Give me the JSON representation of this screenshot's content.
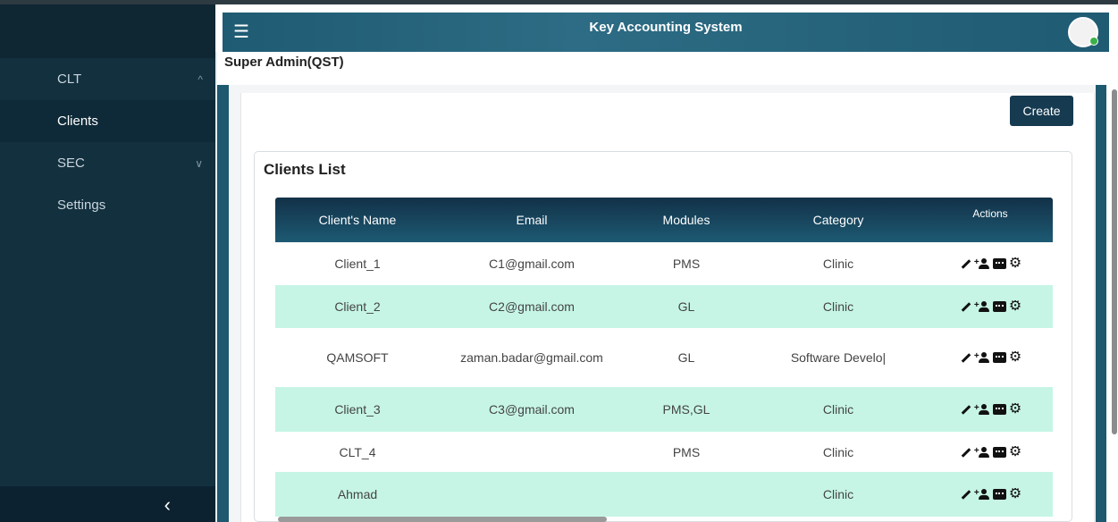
{
  "app": {
    "title": "Key Accounting System",
    "user_label": "Super Admin(QST)",
    "menu_icon": "menu-icon",
    "avatar_icon": "avatar"
  },
  "sidebar": {
    "items": [
      {
        "label": "CLT",
        "chevron": "^"
      },
      {
        "label": "Clients"
      },
      {
        "label": "SEC",
        "chevron": "∨"
      },
      {
        "label": "Settings"
      }
    ],
    "collapse_label": "‹"
  },
  "toolbar": {
    "create_label": "Create"
  },
  "clients": {
    "title": "Clients List",
    "headers": [
      "Client's Name",
      "Email",
      "Modules",
      "Category",
      "Actions"
    ],
    "rows": [
      {
        "name": "Client_1",
        "email": "C1@gmail.com",
        "modules": "PMS",
        "category": "Clinic"
      },
      {
        "name": "Client_2",
        "email": "C2@gmail.com",
        "modules": "GL",
        "category": "Clinic"
      },
      {
        "name": "QAMSOFT",
        "email": "zaman.badar@gmail.com",
        "modules": "GL",
        "category": "Software Develo|"
      },
      {
        "name": "Client_3",
        "email": "C3@gmail.com",
        "modules": "PMS,GL",
        "category": "Clinic"
      },
      {
        "name": "CLT_4",
        "email": "",
        "modules": "PMS",
        "category": "Clinic"
      },
      {
        "name": "Ahmad",
        "email": "",
        "modules": "",
        "category": "Clinic"
      }
    ],
    "action_icons": [
      "pencil-icon",
      "add-user-icon",
      "card-icon",
      "gear-icon"
    ]
  },
  "colors": {
    "sidebar_bg": "#13303f",
    "header_bg": "#1f5b73",
    "row_alt": "#c6f5e6",
    "button_bg": "#163a50"
  }
}
